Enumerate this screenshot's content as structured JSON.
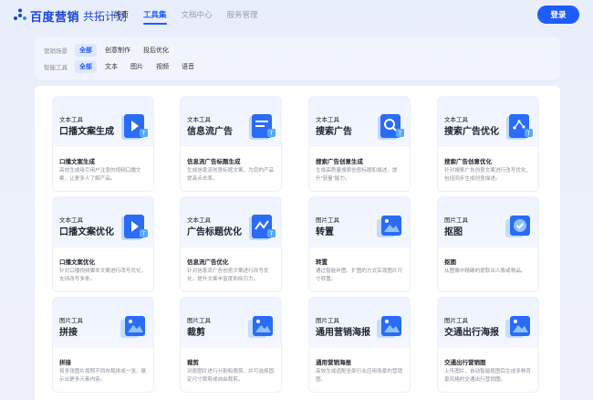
{
  "header": {
    "logo_text": "百度营销",
    "logo_sub": "共拓计划",
    "nav": [
      {
        "label": "首页",
        "state": "normal"
      },
      {
        "label": "工具集",
        "state": "active"
      },
      {
        "label": "文档中心",
        "state": "muted"
      },
      {
        "label": "服务管理",
        "state": "muted"
      }
    ],
    "login_label": "登录"
  },
  "filters": {
    "scene": {
      "label": "营销场景",
      "options": [
        "全部",
        "创意制作",
        "投后优化"
      ],
      "selected": "全部"
    },
    "tool": {
      "label": "智能工具",
      "options": [
        "全部",
        "文本",
        "图片",
        "视频",
        "语音"
      ],
      "selected": "全部"
    }
  },
  "cards": [
    {
      "tag": "文本工具",
      "title": "口播文案生成",
      "name": "口播文案生成",
      "desc": "高效生成吸引用户注意的视频口播文案，让更多人了解产品。",
      "icon": "play-doc-icon"
    },
    {
      "tag": "文本工具",
      "title": "信息流广告",
      "name": "信息流广告标题生成",
      "desc": "生成信息流创意标题文案，为您的产品提高点击率。",
      "icon": "text-doc-icon"
    },
    {
      "tag": "文本工具",
      "title": "搜索广告",
      "name": "搜索广告创意生成",
      "desc": "生成高质量搜索创意标题和描述，提升\"获量\"能力。",
      "icon": "search-doc-icon"
    },
    {
      "tag": "文本工具",
      "title": "搜索广告优化",
      "name": "搜索广告创意优化",
      "desc": "针对搜索广告创意文案进行改写优化，包括同步生成创意描述。",
      "icon": "chart-doc-icon"
    },
    {
      "tag": "文本工具",
      "title": "口播文案优化",
      "name": "口播文案优化",
      "desc": "针对口播视频脚本文案进行改写优化，支持改写多条。",
      "icon": "play-doc-icon"
    },
    {
      "tag": "文本工具",
      "title": "广告标题优化",
      "name": "信息流广告优化",
      "desc": "针对信息流广告创意文案进行改写优化，提升文案丰富度和吸引力。",
      "icon": "trend-doc-icon"
    },
    {
      "tag": "图片工具",
      "title": "转置",
      "name": "转置",
      "desc": "通过智能补图、扩图的方式实现图片尺寸转置。",
      "icon": "image-stack-icon"
    },
    {
      "tag": "图片工具",
      "title": "抠图",
      "name": "抠图",
      "desc": "从图像中精确的提取出人像或物品。",
      "icon": "image-check-icon"
    },
    {
      "tag": "图片工具",
      "title": "拼接",
      "name": "拼接",
      "desc": "将多张图片按照不同布局拼成一张，展示出更多元素内容。",
      "icon": "image-stack-icon"
    },
    {
      "tag": "图片工具",
      "title": "裁剪",
      "name": "裁剪",
      "desc": "对原图片进行分割和裁剪，并可选择固定尺寸裁剪或自由裁剪。",
      "icon": "image-stack-icon"
    },
    {
      "tag": "图片工具",
      "title": "通用营销海报",
      "name": "通用营销海报",
      "desc": "高效生成适配全部行业应用场景的营销图。",
      "icon": "image-stack-icon"
    },
    {
      "tag": "图片工具",
      "title": "交通出行海报",
      "name": "交通出行营销图",
      "desc": "上传图片，自动智能抠图后生成多种背景风格的交通出行营销图。",
      "icon": "image-stack-icon"
    }
  ],
  "colors": {
    "accent": "#1d5dff",
    "icon_light": "#5aa7ff",
    "icon_dark": "#2a6cf5"
  }
}
